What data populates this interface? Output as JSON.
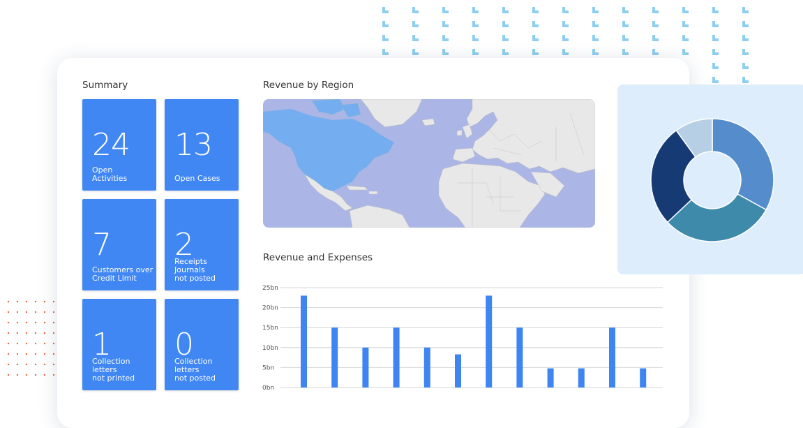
{
  "summary": {
    "title": "Summary",
    "tiles": [
      {
        "value": "24",
        "label": "Open\nActivities"
      },
      {
        "value": "13",
        "label": "Open Cases"
      },
      {
        "value": "7",
        "label": "Customers over\nCredit Limit"
      },
      {
        "value": "2",
        "label": "Receipts Journals\nnot posted"
      },
      {
        "value": "1",
        "label": "Collection letters\nnot printed"
      },
      {
        "value": "0",
        "label": "Collection letters\nnot posted"
      }
    ]
  },
  "map": {
    "title": "Revenue by Region"
  },
  "chart_data": [
    {
      "type": "bar",
      "title": "Revenue and Expenses",
      "y_tick_labels": [
        "0bn",
        "5bn",
        "10bn",
        "15bn",
        "20bn",
        "25bn"
      ],
      "ylim": [
        0,
        25
      ],
      "values": [
        23,
        15,
        10,
        15,
        10,
        8.3,
        23,
        15,
        4.8,
        4.8,
        15,
        4.8
      ],
      "grid": true,
      "color": "#3f85f2"
    },
    {
      "type": "pie",
      "donut": true,
      "values": [
        33,
        30,
        27,
        10
      ],
      "colors": [
        "#548ccc",
        "#3e8aab",
        "#163a74",
        "#b6cfe4"
      ]
    }
  ],
  "colors": {
    "tile": "#4087f4",
    "map_water": "#acb6e6",
    "map_land": "#e8e8e8",
    "map_highlight": "#74aef0",
    "donut_bg": "#deedfb"
  }
}
